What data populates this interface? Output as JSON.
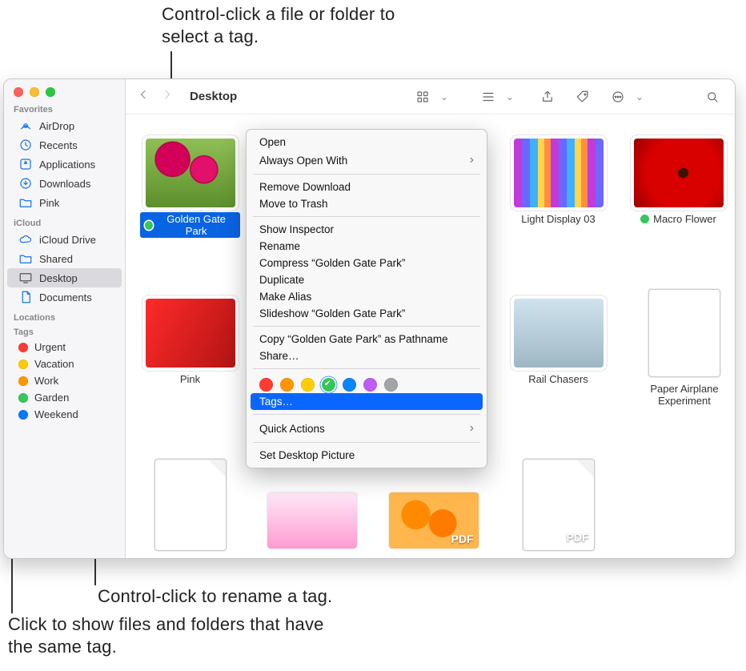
{
  "callouts": {
    "top": "Control-click a file or folder to select a tag.",
    "mid": "Control-click to rename a tag.",
    "bottom": "Click to show files and folders that have the same tag."
  },
  "toolbar": {
    "title": "Desktop"
  },
  "sidebar": {
    "sections": {
      "favorites": "Favorites",
      "icloud": "iCloud",
      "locations": "Locations",
      "tags": "Tags"
    },
    "favorites": [
      {
        "label": "AirDrop"
      },
      {
        "label": "Recents"
      },
      {
        "label": "Applications"
      },
      {
        "label": "Downloads"
      },
      {
        "label": "Pink"
      }
    ],
    "icloud": [
      {
        "label": "iCloud Drive"
      },
      {
        "label": "Shared"
      },
      {
        "label": "Desktop"
      },
      {
        "label": "Documents"
      }
    ],
    "tags": [
      {
        "label": "Urgent",
        "color": "red"
      },
      {
        "label": "Vacation",
        "color": "yellow"
      },
      {
        "label": "Work",
        "color": "orange"
      },
      {
        "label": "Garden",
        "color": "green"
      },
      {
        "label": "Weekend",
        "color": "blue"
      }
    ]
  },
  "files": {
    "golden": "Golden Gate Park",
    "light": "Light Display 03",
    "macro": "Macro Flower",
    "pink": "Pink",
    "rail": "Rail Chasers",
    "paper1": "Paper Airplane",
    "paper2": "Experiment"
  },
  "context_menu": {
    "open": "Open",
    "always_open": "Always Open With",
    "remove_dl": "Remove Download",
    "trash": "Move to Trash",
    "inspector": "Show Inspector",
    "rename": "Rename",
    "compress": "Compress “Golden Gate Park”",
    "duplicate": "Duplicate",
    "alias": "Make Alias",
    "slideshow": "Slideshow “Golden Gate Park”",
    "copy_path": "Copy “Golden Gate Park” as Pathname",
    "share": "Share…",
    "tags": "Tags…",
    "quick": "Quick Actions",
    "set_desktop": "Set Desktop Picture"
  }
}
